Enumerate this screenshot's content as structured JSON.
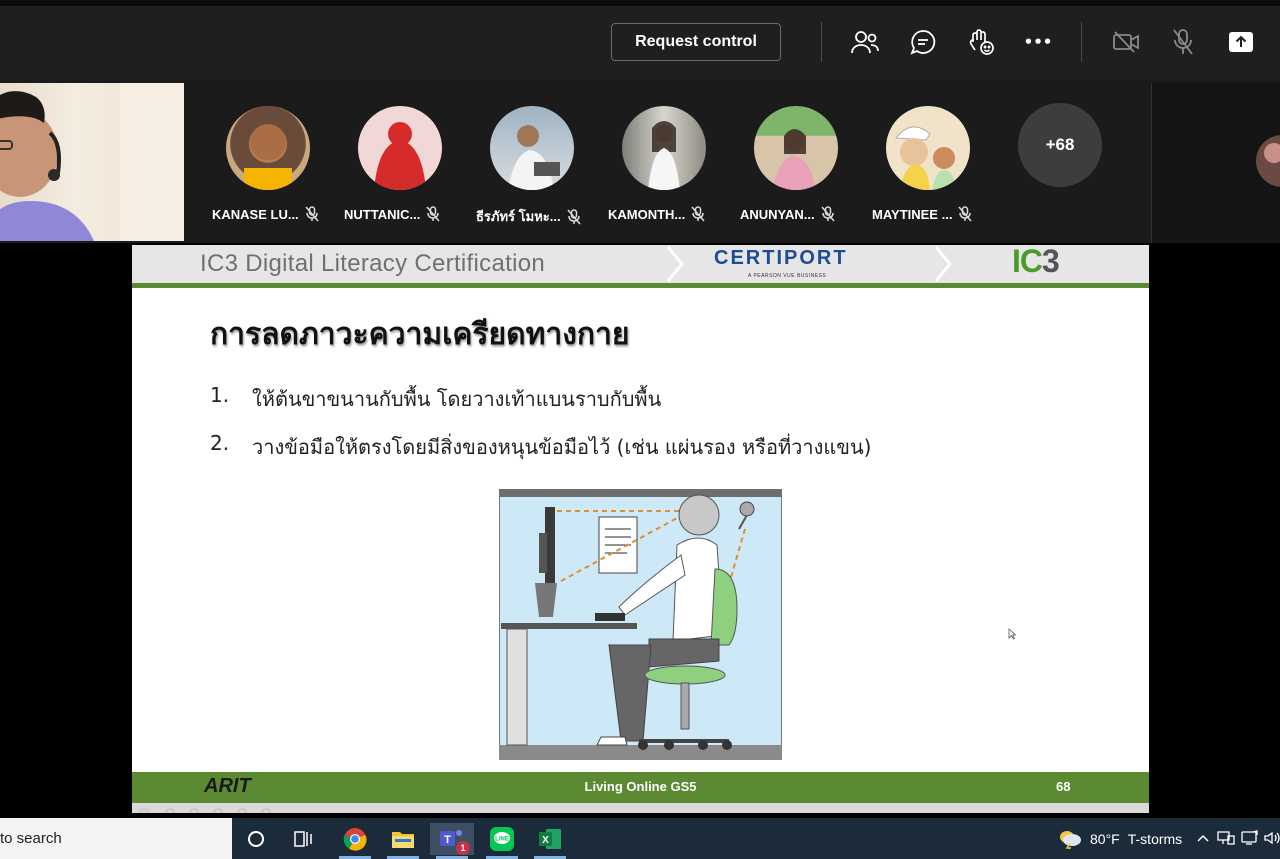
{
  "toolbar": {
    "request_control_label": "Request control",
    "more_label": "•••"
  },
  "participants": [
    {
      "name": "KANASE LU...",
      "color": "#c98a5a"
    },
    {
      "name": "NUTTANIC...",
      "color": "#d83030"
    },
    {
      "name": "ธีรภัทร์ โมหะ...",
      "color": "#6d7a88"
    },
    {
      "name": "KAMONTH...",
      "color": "#b8b0a6"
    },
    {
      "name": "ANUNYAN...",
      "color": "#c9a07c"
    },
    {
      "name": "MAYTINEE ...",
      "color": "#e9c9a0"
    }
  ],
  "more_participants": "+68",
  "slide": {
    "header_title": "IC3 Digital Literacy Certification",
    "certiport": "CERTIPORT",
    "certiport_sub": "A PEARSON VUE BUSINESS",
    "ic3_a": "IC",
    "ic3_b": "3",
    "heading": "การลดภาวะความเครียดทางกาย",
    "bullets": [
      {
        "num": "1.",
        "text": "ให้ต้นขาขนานกับพื้น โดยวางเท้าแบนราบกับพื้น"
      },
      {
        "num": "2.",
        "text": "วางข้อมือให้ตรงโดยมีสิ่งของหนุนข้อมือไว้ (เช่น แผ่นรอง หรือที่วางแขน)"
      }
    ],
    "footer_logo": "ARIT",
    "footer_center": "Living Online GS5",
    "footer_page": "68"
  },
  "taskbar": {
    "search_text": "to search",
    "teams_badge": "1",
    "weather_temp": "80°F",
    "weather_desc": "T-storms"
  },
  "colors": {
    "slide_green": "#5b8a33",
    "toolbar_bg": "#1f1f1f",
    "taskbar_bg": "#1c2b3a"
  }
}
